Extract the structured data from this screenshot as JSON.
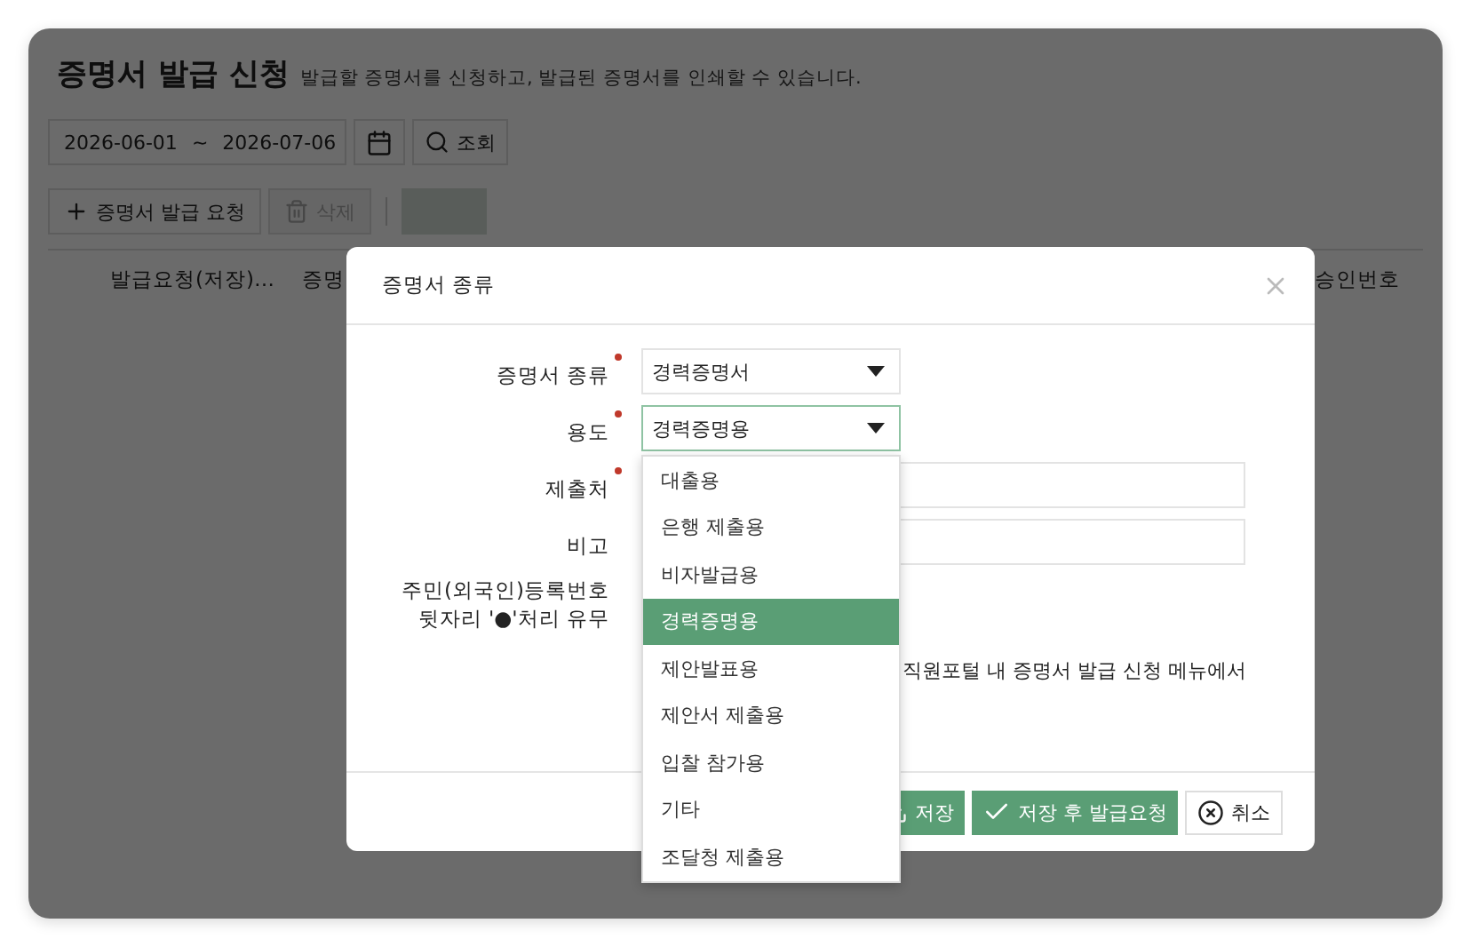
{
  "page": {
    "title": "증명서 발급 신청",
    "subtitle": "발급할 증명서를 신청하고, 발급된 증명서를 인쇄할 수 있습니다."
  },
  "filter": {
    "date_from": "2026-06-01",
    "separator": "~",
    "date_to": "2026-07-06",
    "search_button": "조회"
  },
  "toolbar": {
    "add_button": {
      "label": "증명서 발급 요청",
      "disabled": false
    },
    "delete_button": {
      "label": "삭제",
      "disabled": true
    },
    "print_button": {
      "disabled": true
    }
  },
  "table": {
    "columns": [
      "발급요청(저장)…",
      "증명",
      "승인번호"
    ]
  },
  "dialog": {
    "title": "증명서 종류",
    "fields": [
      {
        "kind": "select",
        "label": "증명서 종류",
        "required": true,
        "value": "경력증명서",
        "focused": false
      },
      {
        "kind": "select",
        "label": "용도",
        "required": true,
        "value": "경력증명용",
        "focused": true
      },
      {
        "kind": "text",
        "label": "제출처",
        "required": true
      },
      {
        "kind": "text",
        "label": "비고",
        "required": false
      },
      {
        "kind": "hidden",
        "label_lines": [
          "주민(외국인)등록번호",
          "뒷자리 '●'처리 유무"
        ],
        "required": false
      }
    ],
    "note": "직원포털 내 증명서 발급 신청 메뉴에서",
    "dropdown": [
      {
        "label": "대출용",
        "selected": false
      },
      {
        "label": "은행 제출용",
        "selected": false
      },
      {
        "label": "비자발급용",
        "selected": false
      },
      {
        "label": "경력증명용",
        "selected": true
      },
      {
        "label": "제안발표용",
        "selected": false
      },
      {
        "label": "제안서 제출용",
        "selected": false
      },
      {
        "label": "입찰 참가용",
        "selected": false
      },
      {
        "label": "기타",
        "selected": false
      },
      {
        "label": "조달청 제출용",
        "selected": false
      }
    ],
    "buttons": [
      {
        "kind": "save",
        "label": "저장"
      },
      {
        "kind": "save_request",
        "label": "저장 후 발급요청"
      },
      {
        "kind": "cancel",
        "label": "취소"
      }
    ]
  }
}
